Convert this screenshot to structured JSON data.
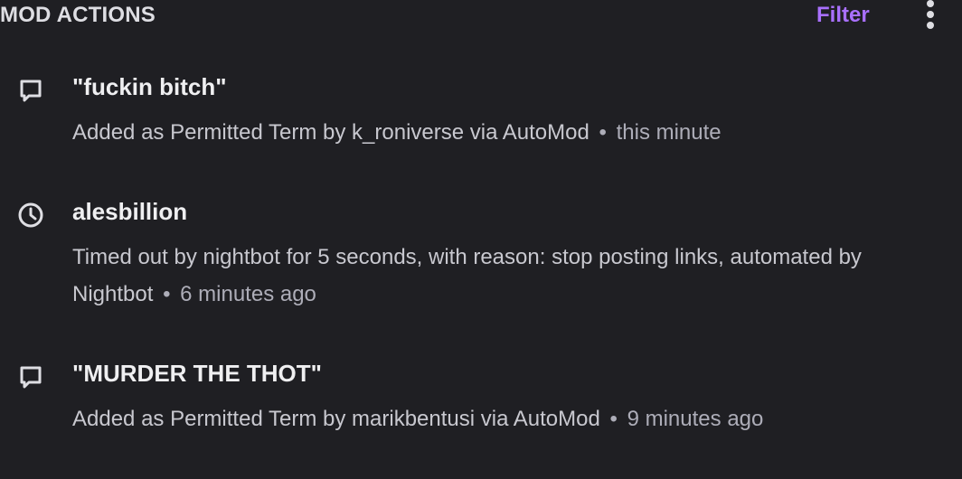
{
  "header": {
    "title": "MOD ACTIONS",
    "filter_label": "Filter",
    "more_icon": "vertical-ellipsis-icon"
  },
  "colors": {
    "background": "#1f1f23",
    "accent": "#a970ff",
    "text_primary": "#efeff1",
    "text_secondary": "#adadb8"
  },
  "actions": [
    {
      "icon": "chat-bubble-icon",
      "title": "\"fuckin bitch\"",
      "detail": "Added as Permitted Term by k_roniverse via AutoMod",
      "separator": "•",
      "time": "this minute"
    },
    {
      "icon": "clock-icon",
      "title": "alesbillion",
      "detail": "Timed out by nightbot for 5 seconds, with reason: stop posting links, automated by Nightbot",
      "separator": "•",
      "time": "6 minutes ago"
    },
    {
      "icon": "chat-bubble-icon",
      "title": "\"MURDER THE THOT\"",
      "detail": "Added as Permitted Term by marikbentusi via AutoMod",
      "separator": "•",
      "time": "9 minutes ago"
    }
  ]
}
